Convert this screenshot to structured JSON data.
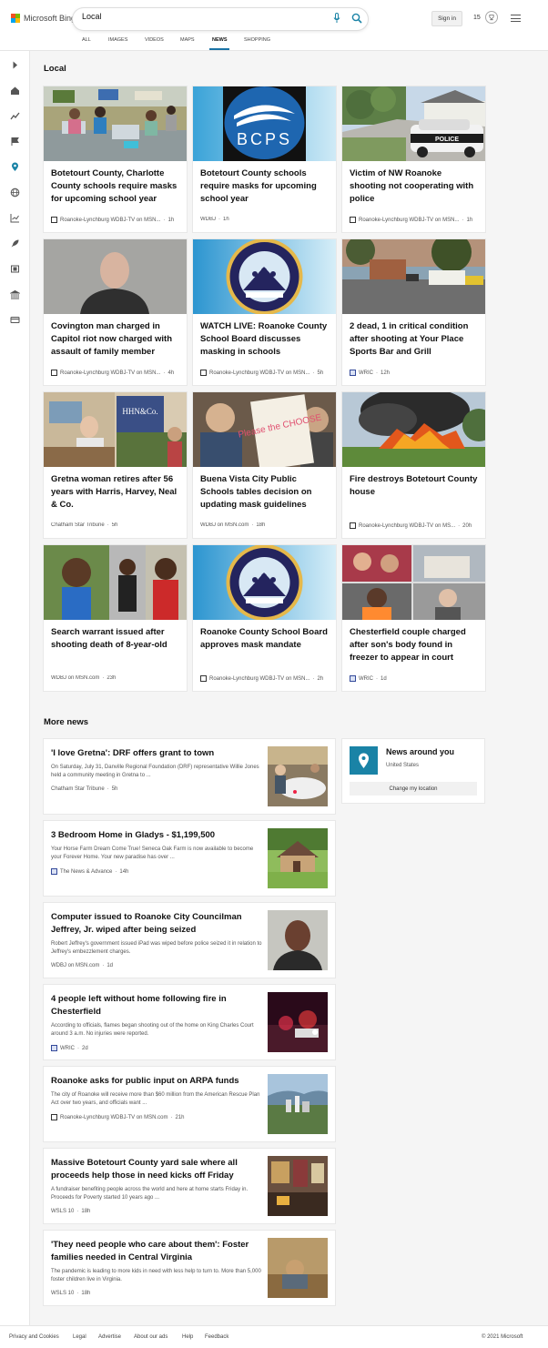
{
  "header": {
    "brand": "Microsoft Bing",
    "search_value": "Local",
    "sign_in": "Sign in",
    "rewards_count": "15"
  },
  "nav": [
    {
      "label": "ALL"
    },
    {
      "label": "IMAGES"
    },
    {
      "label": "VIDEOS"
    },
    {
      "label": "MAPS"
    },
    {
      "label": "NEWS"
    },
    {
      "label": "SHOPPING"
    }
  ],
  "local": {
    "title": "Local",
    "cards": [
      {
        "title": "Botetourt County, Charlotte County schools require masks for upcoming school year",
        "source": "Roanoke-Lynchburg WDBJ-TV on MSN...",
        "time": "1h",
        "icon": "wdbj-logo"
      },
      {
        "title": "Botetourt County schools require masks for upcoming school year",
        "source": "WDBJ",
        "time": "1h",
        "icon": "",
        "image_text": "BCPS"
      },
      {
        "title": "Victim of NW Roanoke shooting not cooperating with police",
        "source": "Roanoke-Lynchburg WDBJ-TV on MSN...",
        "time": "1h",
        "icon": "wdbj-logo",
        "image_text": "POLICE"
      },
      {
        "title": "Covington man charged in Capitol riot now charged with assault of family member",
        "source": "Roanoke-Lynchburg WDBJ-TV on MSN...",
        "time": "4h",
        "icon": "wdbj-logo"
      },
      {
        "title": "WATCH LIVE: Roanoke County School Board discusses masking in schools",
        "source": "Roanoke-Lynchburg WDBJ-TV on MSN...",
        "time": "5h",
        "icon": "wdbj-logo",
        "image_text": "ROANOKE COUNTY PUBLIC SCHOOLS"
      },
      {
        "title": "2 dead, 1 in critical condition after shooting at Your Place Sports Bar and Grill",
        "source": "WRIC",
        "time": "12h",
        "icon": "wric-logo"
      },
      {
        "title": "Gretna woman retires after 56 years with Harris, Harvey, Neal & Co.",
        "source": "Chatham Star Tribune",
        "time": "5h",
        "icon": "",
        "image_text": "HHN&Co."
      },
      {
        "title": "Buena Vista City Public Schools tables decision on updating mask guidelines",
        "source": "WDBJ on MSN.com",
        "time": "18h",
        "icon": "",
        "image_text": "Please the CHOOSE"
      },
      {
        "title": "Fire destroys Botetourt County house",
        "source": "Roanoke-Lynchburg WDBJ-TV on MS...",
        "time": "20h",
        "icon": "wdbj-logo"
      },
      {
        "title": "Search warrant issued after shooting death of 8-year-old",
        "source": "WDBJ on MSN.com",
        "time": "23h",
        "icon": ""
      },
      {
        "title": "Roanoke County School Board approves mask mandate",
        "source": "Roanoke-Lynchburg WDBJ-TV on MSN...",
        "time": "2h",
        "icon": "wdbj-logo",
        "image_text": "ROANOKE COUNTY PUBLIC SCHOOLS"
      },
      {
        "title": "Chesterfield couple charged after son's body found in freezer to appear in court",
        "source": "WRIC",
        "time": "1d",
        "icon": "wric-logo"
      }
    ]
  },
  "more_news": {
    "title": "More news",
    "items": [
      {
        "title": "'I love Gretna': DRF offers grant to town",
        "snippet": "On Saturday, July 31, Danville Regional Foundation (DRF) representative Willie Jones held a community meeting in Gretna to ...",
        "source": "Chatham Star Tribune",
        "time": "5h",
        "icon": ""
      },
      {
        "title": "3 Bedroom Home in Gladys - $1,199,500",
        "snippet": "Your Horse Farm Dream Come True! Seneca Oak Farm is now available to become your Forever Home. Your new paradise has over ...",
        "source": "The News & Advance",
        "time": "14h",
        "icon": "news-advance-logo"
      },
      {
        "title": "Computer issued to Roanoke City Councilman Jeffrey, Jr. wiped after being seized",
        "snippet": "Robert Jeffrey's government issued iPad was wiped before police seized it in relation to Jeffrey's embezzlement charges.",
        "source": "WDBJ on MSN.com",
        "time": "1d",
        "icon": ""
      },
      {
        "title": "4 people left without home following fire in Chesterfield",
        "snippet": "According to officials, flames began shooting out of the home on King Charles Court around 3 a.m. No injuries were reported.",
        "source": "WRIC",
        "time": "2d",
        "icon": "wric-logo"
      },
      {
        "title": "Roanoke asks for public input on ARPA funds",
        "snippet": "The city of Roanoke will receive more than $60 million from the American Rescue Plan Act over two years, and officials want ...",
        "source": "Roanoke-Lynchburg WDBJ-TV on MSN.com",
        "time": "21h",
        "icon": "wdbj-logo"
      },
      {
        "title": "Massive Botetourt County yard sale where all proceeds help those in need kicks off Friday",
        "snippet": "A fundraiser benefiting people across the world and here at home starts Friday in. Proceeds for Poverty started 10 years ago ...",
        "source": "WSLS 10",
        "time": "18h",
        "icon": ""
      },
      {
        "title": "'They need people who care about them': Foster families needed in Central Virginia",
        "snippet": "The pandemic is leading to more kids in need with less help to turn to. More than 5,000 foster children live in Virginia.",
        "source": "WSLS 10",
        "time": "18h",
        "icon": ""
      }
    ]
  },
  "news_around": {
    "title": "News around you",
    "location": "United States",
    "button": "Change my location"
  },
  "footer": {
    "links": [
      "Privacy and Cookies",
      "Legal",
      "Advertise",
      "About our ads",
      "Help",
      "Feedback"
    ],
    "copyright": "© 2021 Microsoft"
  },
  "colors": {
    "accent": "#1a83a6",
    "nav_underline": "#1a73a6"
  }
}
